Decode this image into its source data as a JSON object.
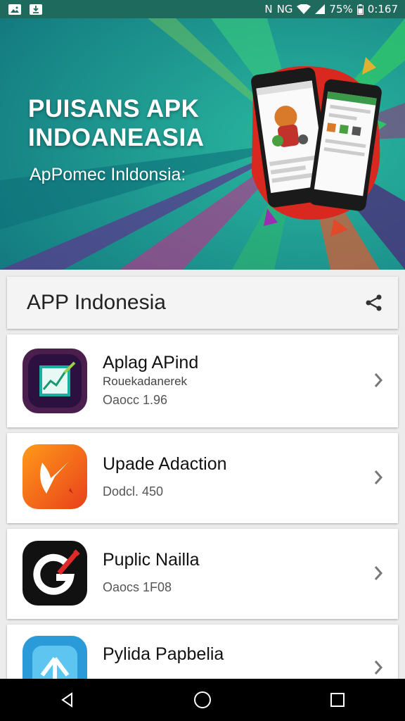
{
  "status_bar": {
    "left_icons": [
      "image-icon",
      "download-icon"
    ],
    "network": "N",
    "network_type": "NG",
    "battery": "75%",
    "time": "0:167"
  },
  "hero": {
    "title": "PUISANS APK\nINDOANEASIA",
    "subtitle": "ApPomec Inldonsia:"
  },
  "section": {
    "title": "APP Indonesia"
  },
  "apps": [
    {
      "name": "Aplag APind",
      "developer": "Rouekadanerek",
      "meta": "Oaocc 1.96",
      "icon": "chart-icon"
    },
    {
      "name": "Upade Adaction",
      "developer": "",
      "meta": "Dodcl. 450",
      "icon": "flame-icon"
    },
    {
      "name": "Puplic Nailla",
      "developer": "",
      "meta": "Oaocs 1F08",
      "icon": "g-logo-icon"
    },
    {
      "name": "Pylida Papbelia",
      "developer": "",
      "meta": "",
      "icon": "arrow-up-icon"
    }
  ],
  "colors": {
    "accent_teal": "#1a8c8a",
    "status_bar": "#1e6b5e",
    "nav_bar": "#000000",
    "card": "#ffffff"
  }
}
